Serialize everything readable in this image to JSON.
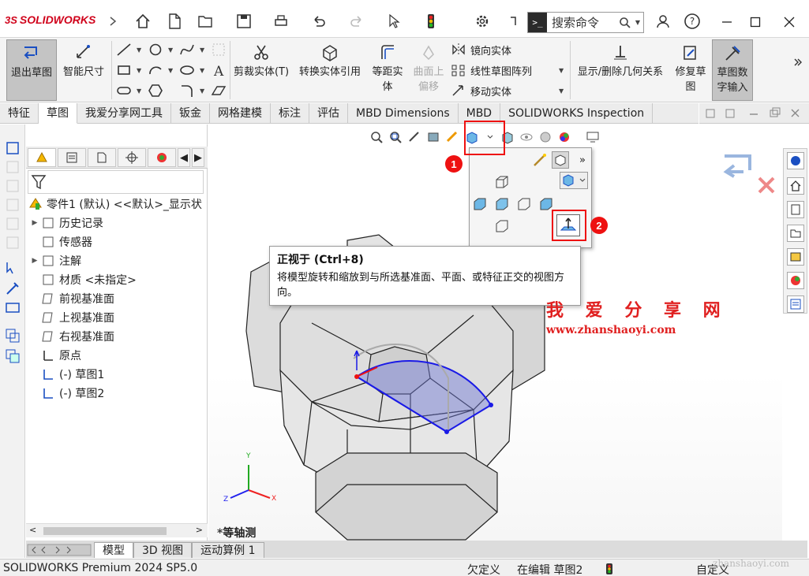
{
  "app": {
    "logo_prefix": "3S",
    "logo_text": "SOLIDWORKS",
    "search_placeholder": "搜索命令"
  },
  "toolbar": {
    "exit_sketch": "退出草图",
    "smart_dim": "智能尺寸",
    "trim": "剪裁实体(T)",
    "convert": "转换实体引用",
    "offset": "等距实体",
    "surface_offset": "曲面上偏移",
    "mirror": "镜向实体",
    "linear_pattern": "线性草图阵列",
    "move": "移动实体",
    "show_delete": "显示/删除几何关系",
    "repair": "修复草图",
    "numeric_input": "草图数字输入"
  },
  "tabs": [
    "特征",
    "草图",
    "我爱分享网工具",
    "钣金",
    "网格建模",
    "标注",
    "评估",
    "MBD Dimensions",
    "MBD",
    "SOLIDWORKS Inspection"
  ],
  "active_tab": 1,
  "tree": {
    "root": "零件1 (默认) <<默认>_显示状",
    "items": [
      "历史记录",
      "传感器",
      "注解",
      "材质 <未指定>",
      "前视基准面",
      "上视基准面",
      "右视基准面",
      "原点",
      "(-) 草图1",
      "(-) 草图2"
    ]
  },
  "tooltip": {
    "title": "正视于   (Ctrl+8)",
    "desc": "将模型旋转和缩放到与所选基准面、平面、或特征正交的视图方向。"
  },
  "badges": [
    "1",
    "2"
  ],
  "watermark": {
    "title": "我 爱 分 享 网",
    "url": "www.zhanshaoyi.com",
    "corner": "zhanshaoyi.com"
  },
  "view_label": "*等轴测",
  "bottom_tabs": [
    "模型",
    "3D 视图",
    "运动算例 1"
  ],
  "status": {
    "product": "SOLIDWORKS Premium 2024 SP5.0",
    "state": "欠定义",
    "editing": "在编辑 草图2",
    "custom": "自定义"
  },
  "axes": {
    "x": "X",
    "y": "Y",
    "z": "Z"
  },
  "colors": {
    "accent": "#d0021b",
    "sketch": "#1a1ae6",
    "callout": "#e11111"
  }
}
